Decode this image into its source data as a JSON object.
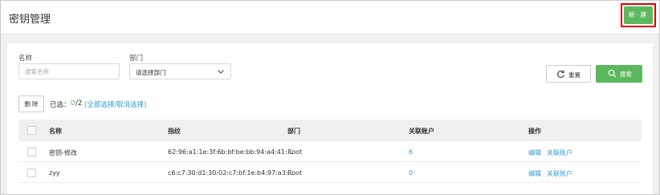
{
  "header": {
    "title": "密钥管理",
    "new_button": "新 建"
  },
  "filters": {
    "name_label": "名称",
    "name_placeholder": "搜索名称",
    "dept_label": "部门",
    "dept_select_value": "请选择部门",
    "reset_button": "重置",
    "search_button": "搜索"
  },
  "toolbar": {
    "delete_button": "删 除",
    "selected_label": "已选：",
    "selected_count": "0",
    "selected_total": "/2",
    "select_toggle": "(全部选择/取消选择)"
  },
  "table": {
    "headers": {
      "name": "名称",
      "fingerprint": "指纹",
      "department": "部门",
      "linked_accounts": "关联账户",
      "operations": "操作"
    },
    "rows": [
      {
        "name": "密钥-修改",
        "fingerprint": "62:96:a1:1e:3f:6b:bf:be:bb:94:a4:41:...",
        "department": "Root",
        "linked_accounts": "6",
        "edit": "编辑",
        "link_accounts": "关联账户"
      },
      {
        "name": "zyy",
        "fingerprint": "c6:c7:30:d1:30:02:c7:bf:1e:b4:97:a3:...",
        "department": "Root",
        "linked_accounts": "0",
        "edit": "编辑",
        "link_accounts": "关联账户"
      }
    ]
  },
  "colors": {
    "accent_green": "#5cb85c",
    "link_blue": "#3399cc",
    "highlight_red": "#e00000"
  },
  "icons": {
    "dropdown": "chevron-down-icon",
    "reset": "refresh-icon",
    "search": "search-icon"
  }
}
